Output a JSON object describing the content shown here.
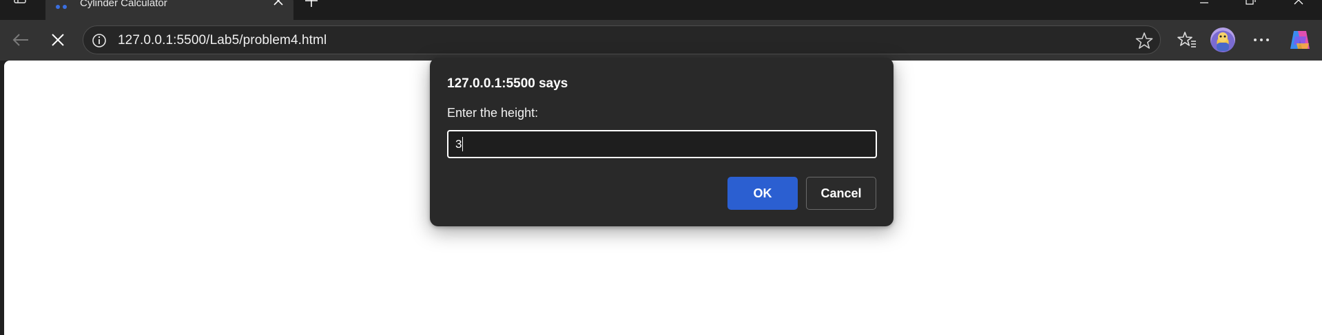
{
  "tab": {
    "title": "Cylinder Calculator"
  },
  "toolbar": {
    "url": "127.0.0.1:5500/Lab5/problem4.html"
  },
  "dialog": {
    "title": "127.0.0.1:5500 says",
    "message": "Enter the height:",
    "input_value": "3",
    "ok_label": "OK",
    "cancel_label": "Cancel"
  },
  "colors": {
    "accent": "#2b5fd1",
    "dialog_bg": "#292929",
    "toolbar_bg": "#333333"
  },
  "icons": [
    "sidebar-icon",
    "favicon-icon",
    "close-icon",
    "plus-icon",
    "minimize-icon",
    "restore-icon",
    "close-window-icon",
    "back-arrow-icon",
    "stop-icon",
    "info-icon",
    "star-icon",
    "favorites-icon",
    "avatar",
    "more-icon",
    "copilot-icon"
  ]
}
